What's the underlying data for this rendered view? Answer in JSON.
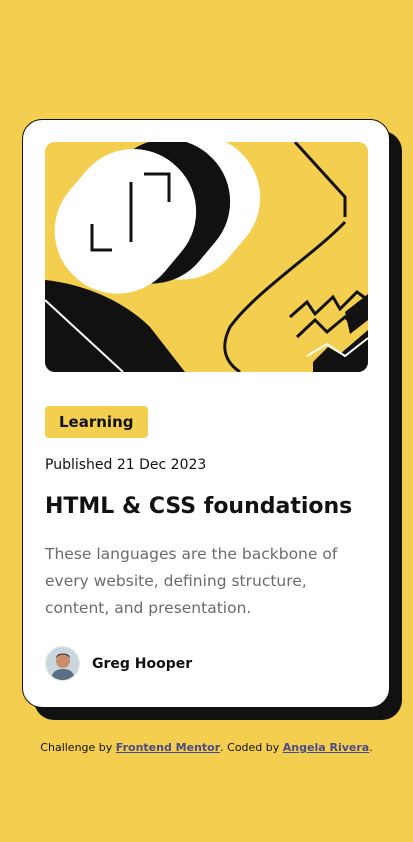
{
  "colors": {
    "background": "#F4CE4F",
    "card": "#FFFFFF",
    "ink": "#111111",
    "muted_text": "#6B6B6B",
    "link": "#4A4A8A"
  },
  "card": {
    "hero_image": "abstract-illustration",
    "category": "Learning",
    "published": "Published 21 Dec 2023",
    "title": "HTML & CSS foundations",
    "description": "These languages are the backbone of every website, defining structure, content, and presentation.",
    "author": {
      "avatar": "avatar-photo",
      "name": "Greg Hooper"
    }
  },
  "attribution": {
    "prefix": "Challenge by ",
    "frontend_mentor": "Frontend Mentor",
    "middle": ". Coded by ",
    "coder": "Angela Rivera",
    "suffix": "."
  }
}
